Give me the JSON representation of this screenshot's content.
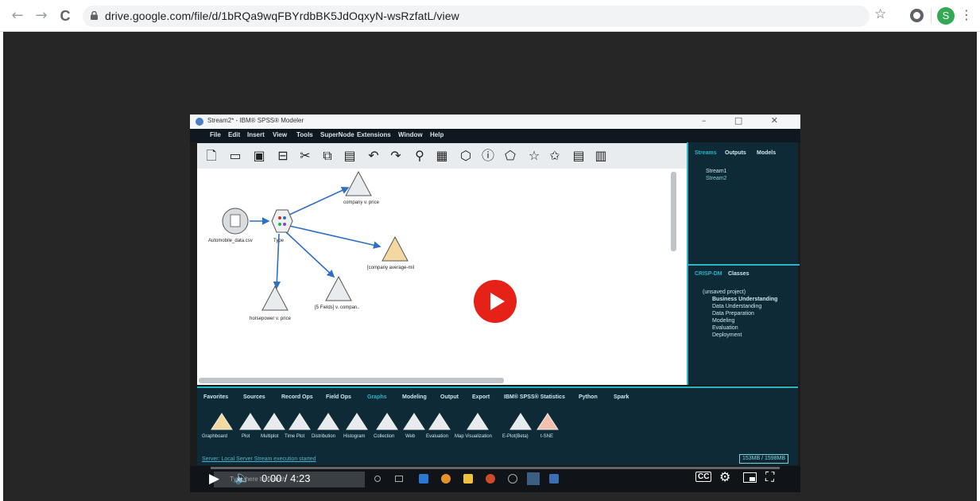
{
  "browser": {
    "back_icon": "←",
    "forward_icon": "→",
    "reload_icon": "C",
    "url": "drive.google.com/file/d/1bRQa9wqFBYrdbBK5JdOqxyN-wsRzfatL/view",
    "star_icon": "☆",
    "avatar_letter": "S",
    "menu_icon": "⋮"
  },
  "app": {
    "title": "Stream2* - IBM® SPSS® Modeler",
    "window_controls": "–  □  ✕",
    "menu": [
      "File",
      "Edit",
      "Insert",
      "View",
      "Tools",
      "SuperNode",
      "Extensions",
      "Window",
      "Help"
    ]
  },
  "canvas": {
    "nodes": [
      {
        "label": "Automobile_data.csv"
      },
      {
        "label": "Type"
      },
      {
        "label": "company v. price"
      },
      {
        "label": "[company average-mil"
      },
      {
        "label": "horsepower v. price"
      },
      {
        "label": "[5 Fields] v. compan.."
      }
    ]
  },
  "right_panel": {
    "tabs_top": [
      "Streams",
      "Outputs",
      "Models"
    ],
    "streams": [
      "Stream1",
      "Stream2"
    ],
    "tabs_bottom": [
      "CRISP-DM",
      "Classes"
    ],
    "project_root": "(unsaved project)",
    "phases": [
      "Business Understanding",
      "Data Understanding",
      "Data Preparation",
      "Modeling",
      "Evaluation",
      "Deployment"
    ]
  },
  "palette": {
    "tabs": [
      "Favorites",
      "Sources",
      "Record Ops",
      "Field Ops",
      "Graphs",
      "Modeling",
      "Output",
      "Export",
      "IBM® SPSS® Statistics",
      "Python",
      "Spark"
    ],
    "active_tab": "Graphs",
    "nodes": [
      "Graphboard",
      "Plot",
      "Multiplot",
      "Time Plot",
      "Distribution",
      "Histogram",
      "Collection",
      "Web",
      "Evaluation",
      "Map Visualization",
      "E-Plot(Beta)",
      "t-SNE"
    ]
  },
  "status": {
    "server": "Server: Local Server   Stream execution started",
    "memory": "153MB / 1598MB"
  },
  "taskbar": {
    "search_placeholder": "Type here to search"
  },
  "player": {
    "time": "0:00 / 4:23",
    "progress": 0,
    "colors": {
      "play_button": "#e62117",
      "accent_teal": "#2bb3c6"
    }
  }
}
